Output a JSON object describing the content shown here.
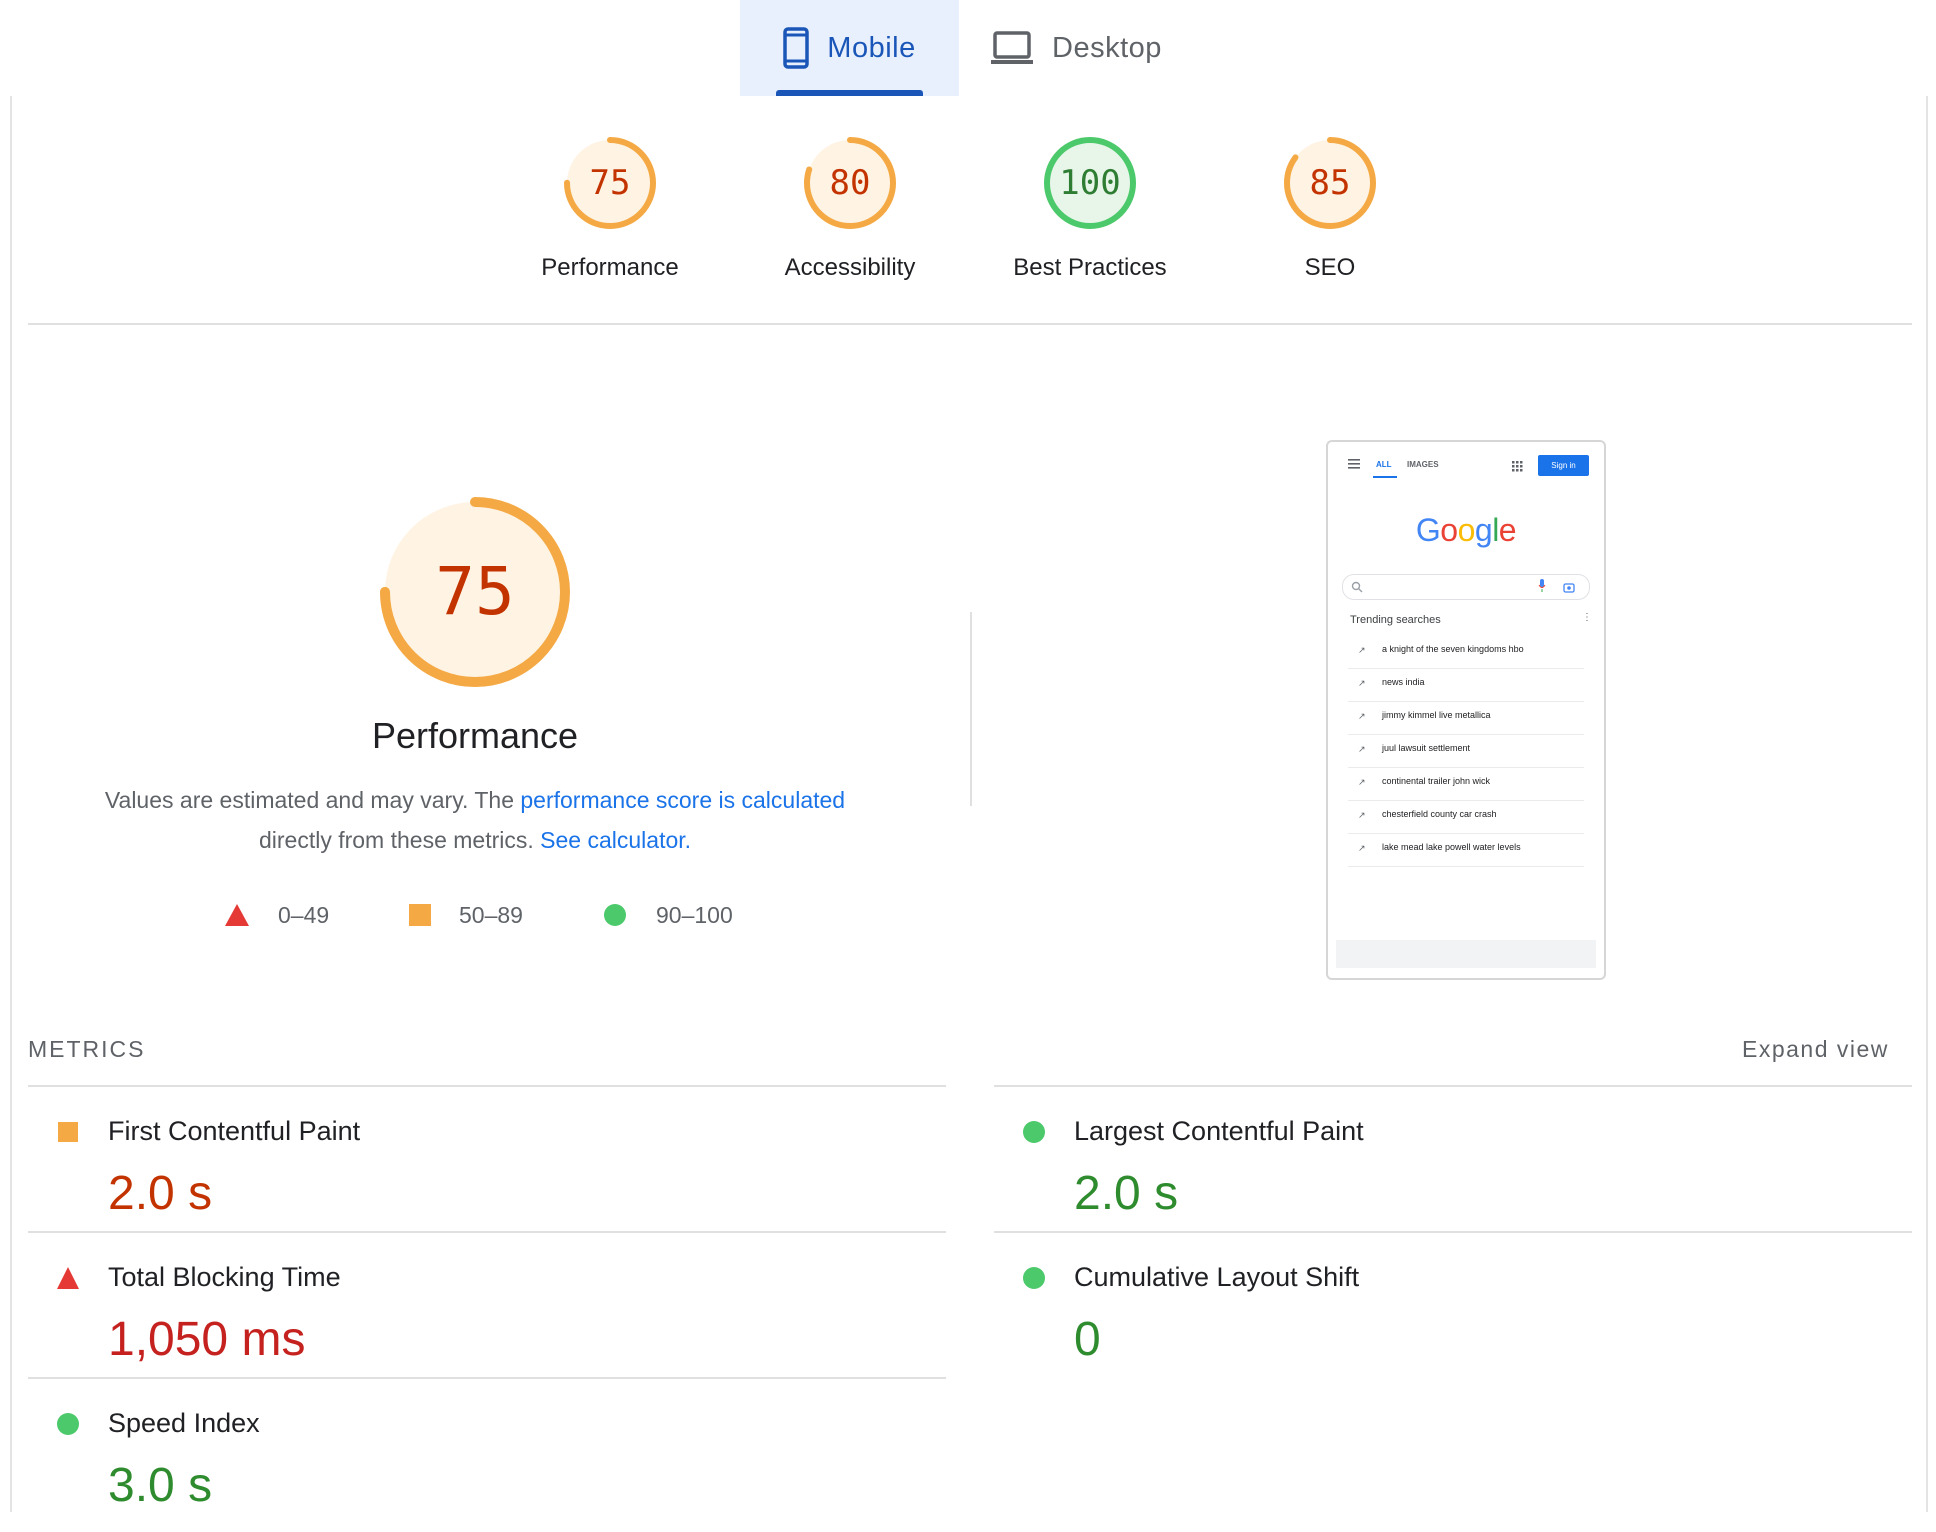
{
  "tabs": {
    "mobile": {
      "label": "Mobile",
      "icon": "smartphone-icon",
      "selected": true
    },
    "desktop": {
      "label": "Desktop",
      "icon": "laptop-icon",
      "selected": false
    }
  },
  "categories": [
    {
      "label": "Performance",
      "score": "75",
      "status": "average"
    },
    {
      "label": "Accessibility",
      "score": "80",
      "status": "average"
    },
    {
      "label": "Best Practices",
      "score": "100",
      "status": "pass"
    },
    {
      "label": "SEO",
      "score": "85",
      "status": "average"
    }
  ],
  "performance": {
    "score": "75",
    "title": "Performance",
    "desc_pre": "Values are estimated and may vary. The ",
    "desc_link1": "performance score is calculated",
    "desc_mid": "directly from these metrics. ",
    "desc_link2": "See calculator."
  },
  "legend": [
    {
      "icon": "fail-triangle-icon",
      "range": "0–49"
    },
    {
      "icon": "average-square-icon",
      "range": "50–89"
    },
    {
      "icon": "pass-circle-icon",
      "range": "90–100"
    }
  ],
  "screenshot": {
    "tab_all": "ALL",
    "tab_images": "IMAGES",
    "signin": "Sign in",
    "logo": "Google",
    "trending_title": "Trending searches",
    "trending": [
      "a knight of the seven kingdoms hbo",
      "news india",
      "jimmy kimmel live metallica",
      "juul lawsuit settlement",
      "continental trailer john wick",
      "chesterfield county car crash",
      "lake mead lake powell water levels"
    ]
  },
  "metrics": {
    "header": "METRICS",
    "expand": "Expand view",
    "items": [
      {
        "label": "First Contentful Paint",
        "value": "2.0 s",
        "status": "average"
      },
      {
        "label": "Largest Contentful Paint",
        "value": "2.0 s",
        "status": "pass"
      },
      {
        "label": "Total Blocking Time",
        "value": "1,050 ms",
        "status": "fail"
      },
      {
        "label": "Cumulative Layout Shift",
        "value": "0",
        "status": "pass"
      },
      {
        "label": "Speed Index",
        "value": "3.0 s",
        "status": "pass"
      }
    ]
  },
  "colors": {
    "average": "#f4a944",
    "average_text": "#c33300",
    "pass": "#2e9c3e",
    "pass_icon": "#4cc96b",
    "fail": "#e53935",
    "fail_text": "#c5221f",
    "link": "#1a73e8",
    "accent": "#1a56b8"
  }
}
